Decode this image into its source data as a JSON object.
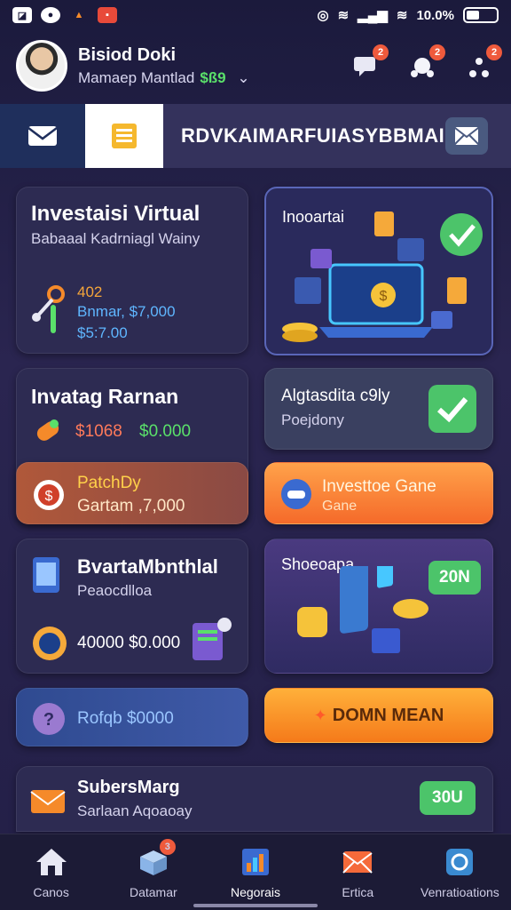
{
  "status_bar": {
    "left_icons": [
      "gallery-icon",
      "shield-icon",
      "fire-icon",
      "app-icon"
    ],
    "battery_text": "10.0%"
  },
  "header": {
    "name": "Bisiod Doki",
    "subtitle": "Mamaep Mantlad",
    "amount": "$ß9",
    "badges": {
      "chat": "2",
      "puzzle": "2",
      "share": "2"
    }
  },
  "top_bar": {
    "title": "RDVKAIMARFUIASYBBMAI"
  },
  "cards": {
    "investasi": {
      "title": "Investaisi Virtual",
      "subtitle": "Babaaal Kadrniagl Wainy",
      "num1": "402",
      "line2": "Bnmar, $7,000",
      "line3": "$5:7.00"
    },
    "inooartai": {
      "title": "Inooartai"
    },
    "invatag": {
      "title": "Invatag Rarnan",
      "amount_a": "$1068",
      "amount_b": "$0.000"
    },
    "algtascita": {
      "title": "Algtasdita c9ly",
      "subtitle": "Poejdony"
    },
    "patchdy": {
      "title": "PatchDy",
      "subtitle": "Gartam ,7,000"
    },
    "investgame": {
      "title": "Investtoe Gane",
      "subtitle": "Gane"
    },
    "bvarta": {
      "title": "BvartaMbnthlal",
      "subtitle": "Peaocdlloa",
      "amounts": "40000 $0.000"
    },
    "shoeapa": {
      "title": "Shoeoapa",
      "badge": "20N"
    },
    "rotqb": {
      "label": "Rofqb $0000"
    },
    "orange_btn": {
      "label": "DOMN MEAN"
    },
    "subersvarg": {
      "title": "SubersMarg",
      "subtitle": "Sarlaan Aqoaoay",
      "cta": "30U"
    }
  },
  "nav": {
    "items": [
      {
        "label": "Canos",
        "icon": "home-icon",
        "badge": ""
      },
      {
        "label": "Datamar",
        "icon": "box-icon",
        "badge": "3"
      },
      {
        "label": "Negorais",
        "icon": "chart-icon",
        "badge": ""
      },
      {
        "label": "Ertica",
        "icon": "envelope-icon",
        "badge": ""
      },
      {
        "label": "Venratioations",
        "icon": "wallet-icon",
        "badge": ""
      }
    ]
  },
  "colors": {
    "background": "#231f47",
    "card": "#2d2b52",
    "accent_orange": "#f58a2a",
    "accent_green": "#5ae06a",
    "accent_blue": "#3f7ad0"
  }
}
